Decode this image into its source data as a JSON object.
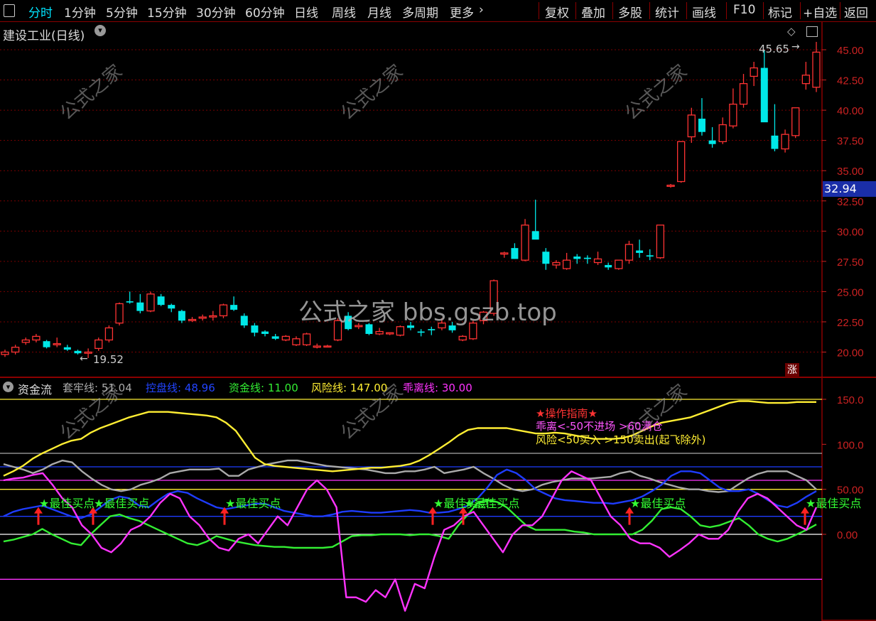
{
  "toolbar": {
    "tabs": [
      "分时",
      "1分钟",
      "5分钟",
      "15分钟",
      "30分钟",
      "60分钟",
      "日线",
      "周线",
      "月线",
      "多周期",
      "更多"
    ],
    "active_tab": "分时",
    "buttons": [
      "复权",
      "叠加",
      "多股",
      "统计",
      "画线",
      "F10",
      "标记",
      "+自选",
      "返回"
    ]
  },
  "stock": {
    "title": "建设工业(日线)",
    "current_price_label": "32.94",
    "high_label": "45.65",
    "low_label": "19.52",
    "zhang_badge": "涨"
  },
  "watermark_center": "公式之家 bbs.gszb.top",
  "indicator": {
    "name": "资金流",
    "values": [
      {
        "label": "套牢线: 51.04",
        "color": "#aaaaaa"
      },
      {
        "label": "控盘线: 48.96",
        "color": "#1e3cff"
      },
      {
        "label": "资金线: 11.00",
        "color": "#33ee33"
      },
      {
        "label": "风险线: 147.00",
        "color": "#ffee33"
      },
      {
        "label": "乖离线: 30.00",
        "color": "#ff33ff"
      }
    ],
    "guide_title": "★操作指南★",
    "guide_line1": "乖离<-50不进场 >60满仓",
    "guide_line2": "风险<50买入 >150卖出(起飞除外)",
    "buy_label": "最佳买点"
  },
  "chart_data": [
    {
      "type": "candlestick",
      "title": "建设工业(日线)",
      "y_ticks": [
        "45.00",
        "42.50",
        "40.00",
        "37.50",
        "35.00",
        "32.50",
        "30.00",
        "27.50",
        "25.00",
        "22.50",
        "20.00"
      ],
      "ylim": [
        18.2,
        46.3
      ],
      "annotations": {
        "high": 45.65,
        "low": 19.52,
        "current": 32.94
      },
      "candles": [
        [
          19.8,
          20.2,
          19.6,
          20.0
        ],
        [
          20.0,
          20.6,
          19.8,
          20.4
        ],
        [
          20.8,
          21.2,
          20.6,
          21.0
        ],
        [
          21.0,
          21.5,
          20.8,
          21.3
        ],
        [
          20.9,
          21.0,
          20.3,
          20.4
        ],
        [
          20.6,
          21.2,
          20.4,
          20.7
        ],
        [
          20.4,
          20.6,
          20.1,
          20.2
        ],
        [
          20.1,
          20.2,
          19.8,
          19.9
        ],
        [
          19.9,
          20.3,
          19.5,
          20.0
        ],
        [
          20.3,
          21.2,
          20.1,
          21.0
        ],
        [
          21.0,
          22.2,
          20.8,
          22.0
        ],
        [
          22.4,
          24.1,
          22.2,
          24.0
        ],
        [
          24.2,
          25.0,
          24.0,
          24.1
        ],
        [
          24.1,
          24.8,
          23.2,
          23.4
        ],
        [
          23.4,
          25.0,
          23.3,
          24.8
        ],
        [
          24.6,
          24.8,
          23.8,
          23.9
        ],
        [
          23.9,
          24.0,
          23.3,
          23.6
        ],
        [
          23.4,
          23.5,
          22.4,
          22.6
        ],
        [
          22.6,
          22.9,
          22.5,
          22.7
        ],
        [
          22.8,
          23.1,
          22.6,
          22.9
        ],
        [
          22.9,
          23.4,
          22.6,
          23.0
        ],
        [
          23.0,
          24.0,
          22.8,
          23.9
        ],
        [
          23.9,
          24.6,
          23.4,
          23.5
        ],
        [
          23.0,
          23.2,
          22.0,
          22.2
        ],
        [
          22.2,
          22.4,
          21.3,
          21.6
        ],
        [
          21.7,
          21.8,
          21.3,
          21.5
        ],
        [
          21.3,
          21.5,
          21.0,
          21.1
        ],
        [
          21.0,
          21.4,
          20.9,
          21.3
        ],
        [
          20.6,
          21.3,
          20.5,
          21.1
        ],
        [
          20.6,
          21.6,
          20.5,
          21.5
        ],
        [
          20.4,
          20.7,
          20.3,
          20.5
        ],
        [
          20.5,
          20.6,
          20.4,
          20.5
        ],
        [
          21.0,
          22.8,
          20.9,
          22.6
        ],
        [
          23.0,
          23.3,
          21.8,
          21.9
        ],
        [
          22.1,
          22.4,
          21.9,
          22.2
        ],
        [
          22.3,
          22.4,
          21.4,
          21.5
        ],
        [
          21.5,
          22.0,
          21.4,
          21.7
        ],
        [
          21.5,
          21.6,
          21.4,
          21.6
        ],
        [
          21.4,
          22.2,
          21.3,
          22.1
        ],
        [
          22.2,
          22.5,
          21.8,
          22.0
        ],
        [
          21.7,
          21.9,
          21.3,
          21.6
        ],
        [
          21.9,
          22.1,
          21.4,
          21.8
        ],
        [
          22.0,
          22.8,
          21.8,
          22.4
        ],
        [
          22.2,
          22.5,
          21.6,
          21.8
        ],
        [
          21.0,
          21.4,
          20.9,
          21.3
        ],
        [
          21.1,
          22.6,
          21.0,
          22.4
        ],
        [
          22.6,
          23.4,
          22.3,
          23.3
        ],
        [
          23.2,
          26.0,
          23.0,
          25.9
        ],
        [
          28.1,
          28.3,
          27.8,
          28.2
        ],
        [
          28.6,
          29.0,
          27.7,
          27.7
        ],
        [
          27.6,
          31.0,
          27.5,
          30.5
        ],
        [
          30.0,
          32.6,
          29.5,
          29.3
        ],
        [
          28.3,
          28.6,
          26.8,
          27.3
        ],
        [
          27.2,
          27.6,
          26.9,
          27.4
        ],
        [
          26.9,
          28.2,
          26.8,
          27.6
        ],
        [
          27.9,
          28.1,
          27.3,
          27.7
        ],
        [
          27.8,
          28.0,
          27.3,
          27.7
        ],
        [
          27.4,
          28.3,
          27.2,
          27.7
        ],
        [
          27.2,
          27.4,
          26.8,
          27.0
        ],
        [
          26.9,
          27.6,
          26.8,
          27.6
        ],
        [
          27.6,
          29.2,
          27.3,
          28.9
        ],
        [
          28.4,
          29.3,
          27.8,
          28.2
        ],
        [
          28.0,
          28.5,
          27.6,
          27.9
        ],
        [
          27.8,
          30.5,
          27.7,
          30.5
        ],
        [
          33.7,
          33.9,
          33.6,
          33.8
        ],
        [
          34.1,
          37.4,
          34.0,
          37.4
        ],
        [
          37.8,
          40.2,
          37.3,
          39.6
        ],
        [
          39.3,
          41.0,
          37.9,
          38.2
        ],
        [
          37.5,
          38.6,
          36.9,
          37.2
        ],
        [
          37.4,
          39.4,
          37.2,
          38.8
        ],
        [
          38.7,
          41.8,
          38.5,
          40.5
        ],
        [
          40.5,
          43.0,
          40.2,
          42.2
        ],
        [
          42.8,
          44.0,
          42.0,
          43.5
        ],
        [
          43.5,
          45.0,
          39.2,
          39.0
        ],
        [
          37.9,
          40.5,
          36.6,
          36.8
        ],
        [
          36.8,
          38.4,
          36.5,
          38.0
        ],
        [
          37.9,
          40.2,
          37.7,
          40.2
        ],
        [
          42.2,
          44.0,
          41.7,
          42.9
        ],
        [
          41.9,
          45.65,
          41.5,
          44.8
        ]
      ]
    },
    {
      "type": "line",
      "title": "资金流",
      "y_ticks": [
        "150.0",
        "100.0",
        "50.00",
        "0.00"
      ],
      "ylim": [
        -96,
        173
      ],
      "hlines": [
        {
          "y": 150,
          "color": "#ffee33"
        },
        {
          "y": 90,
          "color": "#aaaaaa"
        },
        {
          "y": 75,
          "color": "#1e3cff"
        },
        {
          "y": 60,
          "color": "#ff33ff"
        },
        {
          "y": 50,
          "color": "#ffee33"
        },
        {
          "y": 20,
          "color": "#1e3cff"
        },
        {
          "y": 0,
          "color": "#ffffff"
        },
        {
          "y": -50,
          "color": "#ff33ff"
        }
      ],
      "series": [
        {
          "name": "套牢线",
          "color": "#aaaaaa",
          "values": [
            78,
            75,
            72,
            68,
            72,
            78,
            82,
            80,
            70,
            62,
            55,
            50,
            48,
            50,
            55,
            58,
            62,
            68,
            70,
            72,
            72,
            72,
            73,
            65,
            65,
            72,
            75,
            78,
            80,
            82,
            82,
            80,
            78,
            76,
            75,
            74,
            73,
            72,
            70,
            68,
            68,
            70,
            70,
            72,
            75,
            68,
            70,
            72,
            75,
            68,
            62,
            55,
            50,
            48,
            50,
            55,
            58,
            60,
            62,
            62,
            62,
            63,
            64,
            68,
            70,
            65,
            62,
            58,
            55,
            52,
            50,
            50,
            48,
            47,
            48,
            55,
            62,
            67,
            70,
            70,
            70,
            65,
            60,
            50
          ]
        },
        {
          "name": "控盘线",
          "color": "#1e3cff",
          "values": [
            20,
            25,
            28,
            30,
            32,
            28,
            24,
            20,
            18,
            22,
            30,
            38,
            42,
            40,
            32,
            30,
            38,
            45,
            48,
            46,
            40,
            35,
            30,
            28,
            30,
            32,
            34,
            34,
            30,
            26,
            24,
            22,
            20,
            20,
            22,
            25,
            26,
            25,
            24,
            24,
            25,
            26,
            27,
            26,
            24,
            24,
            25,
            28,
            32,
            40,
            52,
            66,
            72,
            68,
            60,
            50,
            45,
            40,
            38,
            37,
            36,
            35,
            35,
            34,
            36,
            38,
            42,
            48,
            55,
            65,
            70,
            70,
            68,
            60,
            52,
            48,
            48,
            50,
            45,
            38,
            32,
            30,
            35,
            42,
            48
          ]
        },
        {
          "name": "资金线",
          "color": "#33ee33",
          "values": [
            -8,
            -6,
            -3,
            0,
            6,
            0,
            -5,
            -10,
            -12,
            0,
            10,
            20,
            22,
            18,
            15,
            10,
            5,
            0,
            -5,
            -10,
            -12,
            -8,
            -2,
            -5,
            -8,
            -10,
            -12,
            -13,
            -14,
            -14,
            -15,
            -15,
            -15,
            -15,
            -14,
            -8,
            -2,
            -1,
            -1,
            0,
            0,
            0,
            -1,
            0,
            0,
            -2,
            -5,
            10,
            22,
            35,
            38,
            36,
            30,
            20,
            10,
            5,
            5,
            5,
            5,
            3,
            2,
            0,
            0,
            0,
            0,
            0,
            5,
            15,
            28,
            30,
            28,
            20,
            10,
            8,
            10,
            14,
            18,
            10,
            0,
            -5,
            -8,
            -5,
            0,
            5,
            11
          ]
        },
        {
          "name": "风险线",
          "color": "#ffee33",
          "values": [
            65,
            70,
            76,
            84,
            90,
            95,
            100,
            104,
            106,
            113,
            118,
            122,
            126,
            130,
            133,
            136,
            136,
            136,
            135,
            134,
            133,
            132,
            130,
            124,
            115,
            100,
            85,
            78,
            76,
            75,
            74,
            73,
            72,
            71,
            70,
            71,
            72,
            73,
            74,
            74,
            75,
            76,
            78,
            82,
            88,
            95,
            102,
            110,
            116,
            118,
            118,
            118,
            118,
            116,
            114,
            112,
            112,
            113,
            112,
            110,
            108,
            106,
            106,
            106,
            107,
            110,
            115,
            120,
            124,
            126,
            128,
            130,
            134,
            138,
            142,
            146,
            148,
            148,
            147,
            146,
            146,
            146,
            147,
            147,
            147
          ]
        },
        {
          "name": "乖离线",
          "color": "#ff33ff",
          "values": [
            60,
            62,
            63,
            66,
            68,
            55,
            40,
            30,
            10,
            0,
            -15,
            -20,
            -10,
            5,
            10,
            20,
            35,
            45,
            40,
            20,
            10,
            -5,
            -15,
            -18,
            -5,
            0,
            -10,
            5,
            20,
            10,
            30,
            50,
            60,
            50,
            30,
            -70,
            -70,
            -75,
            -62,
            -70,
            -50,
            -85,
            -55,
            -60,
            -25,
            5,
            10,
            20,
            25,
            10,
            -5,
            -20,
            0,
            10,
            10,
            20,
            40,
            60,
            70,
            65,
            60,
            40,
            20,
            10,
            -5,
            -10,
            -10,
            -15,
            -25,
            -18,
            -10,
            0,
            -5,
            -5,
            5,
            25,
            40,
            45,
            40,
            30,
            20,
            10,
            5,
            30
          ]
        }
      ]
    }
  ]
}
